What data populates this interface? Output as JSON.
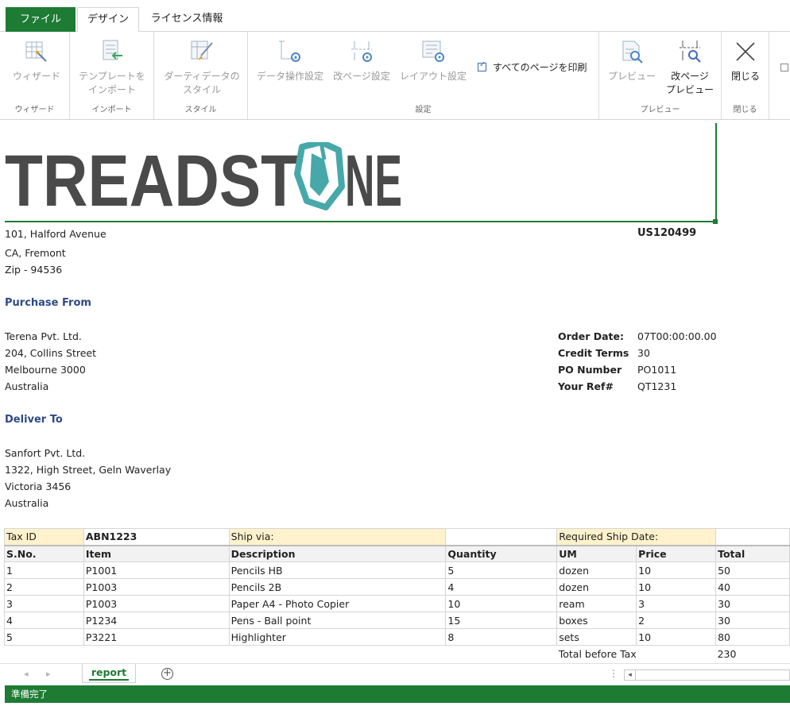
{
  "tabs": {
    "file": "ファイル",
    "design": "デザイン",
    "license": "ライセンス情報"
  },
  "ribbon": {
    "wizard": {
      "button": "ウィザード",
      "group": "ウィザード"
    },
    "import": {
      "button_line1": "テンプレートを",
      "button_line2": "インポート",
      "group": "インポート"
    },
    "style": {
      "button_line1": "ダーティデータの",
      "button_line2": "スタイル",
      "group": "スタイル"
    },
    "settings": {
      "data_ops": "データ操作設定",
      "page_break": "改ページ設定",
      "layout": "レイアウト設定",
      "print_all": "すべてのページを印刷",
      "group": "設定"
    },
    "preview": {
      "preview": "プレビュー",
      "page_break_line1": "改ページ",
      "page_break_line2": "プレビュー",
      "group": "プレビュー"
    },
    "close": {
      "button": "閉じる",
      "group": "閉じる"
    }
  },
  "logo": {
    "text_left": "TREADST",
    "text_right": "NE",
    "brand_color": "#47a8a9",
    "text_color": "#4a4a4a"
  },
  "company": {
    "address1": "101, Halford Avenue",
    "address2": "CA, Fremont",
    "zip": "Zip - 94536",
    "doc_id": "US120499"
  },
  "purchase_from": {
    "heading": "Purchase From",
    "lines": [
      "Terena Pvt. Ltd.",
      "204, Collins Street",
      "Melbourne 3000",
      "Australia"
    ]
  },
  "order": {
    "date_label": "Order Date:",
    "date_value": "07T00:00:00.00",
    "terms_label": "Credit Terms",
    "terms_value": "30",
    "po_label": "PO Number",
    "po_value": "PO1011",
    "ref_label": "Your Ref#",
    "ref_value": "QT1231"
  },
  "deliver_to": {
    "heading": "Deliver To",
    "lines": [
      "Sanfort Pvt. Ltd.",
      "1322, High Street, Geln Waverlay",
      "Victoria 3456",
      "Australia"
    ]
  },
  "meta_row": {
    "tax_label": "Tax ID",
    "tax_value": "ABN1223",
    "ship_via": "Ship via:",
    "ship_date": "Required Ship Date:"
  },
  "table": {
    "headers": [
      "S.No.",
      "Item",
      "Description",
      "Quantity",
      "UM",
      "Price",
      "Total"
    ],
    "rows": [
      [
        "1",
        "P1001",
        "Pencils HB",
        "5",
        "dozen",
        "10",
        "50"
      ],
      [
        "2",
        "P1003",
        "Pencils 2B",
        "4",
        "dozen",
        "10",
        "40"
      ],
      [
        "3",
        "P1003",
        "Paper A4 - Photo Copier",
        "10",
        "ream",
        "3",
        "30"
      ],
      [
        "4",
        "P1234",
        "Pens - Ball point",
        "15",
        "boxes",
        "2",
        "30"
      ],
      [
        "5",
        "P3221",
        "Highlighter",
        "8",
        "sets",
        "10",
        "80"
      ]
    ],
    "total_label": "Total before Tax",
    "total_value": "230"
  },
  "sheet_tab": "report",
  "status": "準備完了",
  "accent_color": "#1e7b34"
}
